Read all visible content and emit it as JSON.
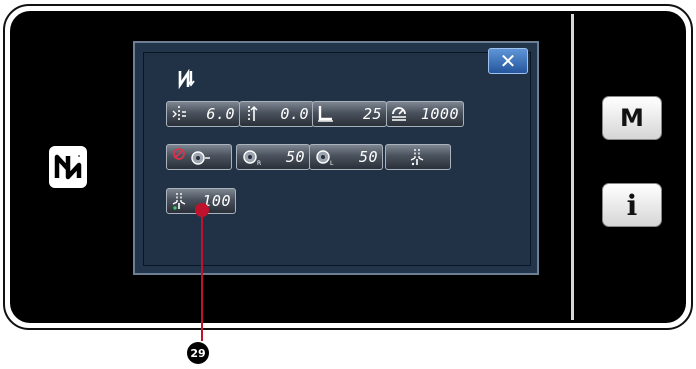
{
  "side": {
    "m_label": "M",
    "info_label": "i"
  },
  "screen": {
    "close_label": "✕",
    "rows": [
      [
        {
          "name": "stitch-length-button",
          "icon": "stitch-length-icon",
          "value": "6.0"
        },
        {
          "name": "needle-thread-tension-button",
          "icon": "thread-tension-icon",
          "value": "0.0"
        },
        {
          "name": "presser-foot-pressure-button",
          "icon": "presser-foot-icon",
          "value": "25"
        },
        {
          "name": "max-sewing-speed-button",
          "icon": "speed-icon",
          "value": "1000"
        }
      ],
      [
        {
          "name": "thread-trimmer-off-button",
          "icon": "no-trim-icon",
          "value": ""
        },
        {
          "name": "reverse-feed-start-button",
          "icon": "reverse-start-icon",
          "value": "50"
        },
        {
          "name": "reverse-feed-end-button",
          "icon": "reverse-end-icon",
          "value": "50"
        },
        {
          "name": "thread-clamp-button",
          "icon": "thread-clamp-icon",
          "value": ""
        }
      ],
      [
        {
          "name": "clamp-setting-button",
          "icon": "thread-clamp-icon",
          "value": "100"
        }
      ]
    ]
  },
  "callout": {
    "number": "29"
  },
  "colors": {
    "callout": "#c0122c",
    "close_button": "#3a74c0",
    "screen_bg": "#23354b"
  }
}
